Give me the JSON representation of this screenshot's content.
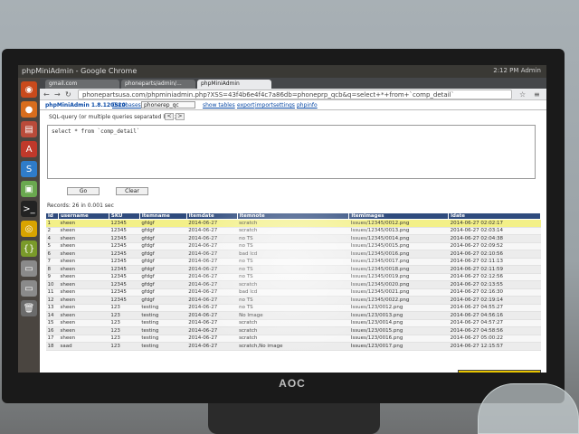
{
  "window": {
    "title": "phpMiniAdmin - Google Chrome",
    "clock": "2:12 PM",
    "user": "Admin"
  },
  "tabs": [
    {
      "label": "gmail.com"
    },
    {
      "label": "phoneparts/admin/..."
    },
    {
      "label": "phpMiniAdmin"
    }
  ],
  "address": {
    "url": "phonepartsusa.com/phpminiadmin.php?XSS=43f4b6e4f4c7a86db=phoneprp_qcb&q=select+*+from+`comp_detail`"
  },
  "pma": {
    "logo": "phpMiniAdmin 1.8.120510",
    "databases_label": "Databases:",
    "db_selected": "phonerep_qc",
    "links": [
      "show tables",
      "export",
      "import",
      "settings",
      "phpinfo"
    ]
  },
  "query": {
    "label": "SQL-query (or multiple queries separated by \";\")",
    "history_prev": "<",
    "history_next": ">",
    "sql": "select * from `comp_detail`",
    "go_label": "Go",
    "clear_label": "Clear"
  },
  "records": {
    "text": "Records: 26 in 0.001 sec"
  },
  "table": {
    "columns": [
      "id",
      "username",
      "SKU",
      "itemname",
      "itemdate",
      "itemnote",
      "itemimages",
      "idate"
    ],
    "rows": [
      [
        "1",
        "sheen",
        "12345",
        "gfdgf",
        "2014-06-27",
        "scratch",
        "Issues/12345/0012.png",
        "2014-06-27 02:02:17"
      ],
      [
        "2",
        "sheen",
        "12345",
        "gfdgf",
        "2014-06-27",
        "scratch",
        "Issues/12345/0013.png",
        "2014-06-27 02:03:14"
      ],
      [
        "4",
        "sheen",
        "12345",
        "gfdgf",
        "2014-06-27",
        "no TS",
        "Issues/12345/0014.png",
        "2014-06-27 02:04:38"
      ],
      [
        "5",
        "sheen",
        "12345",
        "gfdgf",
        "2014-06-27",
        "no TS",
        "Issues/12345/0015.png",
        "2014-06-27 02:09:52"
      ],
      [
        "6",
        "sheen",
        "12345",
        "gfdgf",
        "2014-06-27",
        "bad lcd",
        "Issues/12345/0016.png",
        "2014-06-27 02:10:56"
      ],
      [
        "7",
        "sheen",
        "12345",
        "gfdgf",
        "2014-06-27",
        "no TS",
        "Issues/12345/0017.png",
        "2014-06-27 02:11:13"
      ],
      [
        "8",
        "sheen",
        "12345",
        "gfdgf",
        "2014-06-27",
        "no TS",
        "Issues/12345/0018.png",
        "2014-06-27 02:11:59"
      ],
      [
        "9",
        "sheen",
        "12345",
        "gfdgf",
        "2014-06-27",
        "no TS",
        "Issues/12345/0019.png",
        "2014-06-27 02:12:56"
      ],
      [
        "10",
        "sheen",
        "12345",
        "gfdgf",
        "2014-06-27",
        "scratch",
        "Issues/12345/0020.png",
        "2014-06-27 02:13:55"
      ],
      [
        "11",
        "sheen",
        "12345",
        "gfdgf",
        "2014-06-27",
        "bad lcd",
        "Issues/12345/0021.png",
        "2014-06-27 02:16:30"
      ],
      [
        "12",
        "sheen",
        "12345",
        "gfdgf",
        "2014-06-27",
        "no TS",
        "Issues/12345/0022.png",
        "2014-06-27 02:19:14"
      ],
      [
        "13",
        "sheen",
        "123",
        "testing",
        "2014-06-27",
        "no TS",
        "Issues/123/0012.png",
        "2014-06-27 04:55:27"
      ],
      [
        "14",
        "sheen",
        "123",
        "testing",
        "2014-06-27",
        "No Image",
        "Issues/123/0013.png",
        "2014-06-27 04:56:16"
      ],
      [
        "15",
        "sheen",
        "123",
        "testing",
        "2014-06-27",
        "scratch",
        "Issues/123/0014.png",
        "2014-06-27 04:57:27"
      ],
      [
        "16",
        "sheen",
        "123",
        "testing",
        "2014-06-27",
        "scratch",
        "Issues/123/0015.png",
        "2014-06-27 04:58:56"
      ],
      [
        "17",
        "sheen",
        "123",
        "testing",
        "2014-06-27",
        "scratch",
        "Issues/123/0016.png",
        "2014-06-27 05:00:22"
      ],
      [
        "18",
        "saad",
        "123",
        "testing",
        "2014-06-27",
        "scratch,No image",
        "Issues/123/0017.png",
        "2014-06-27 12:15:57"
      ]
    ]
  },
  "monitor": {
    "brand": "AOC"
  },
  "colors": {
    "header_bg": "#2f4b7d",
    "highlight_row": "#f3f088",
    "link": "#0a4aa6"
  }
}
